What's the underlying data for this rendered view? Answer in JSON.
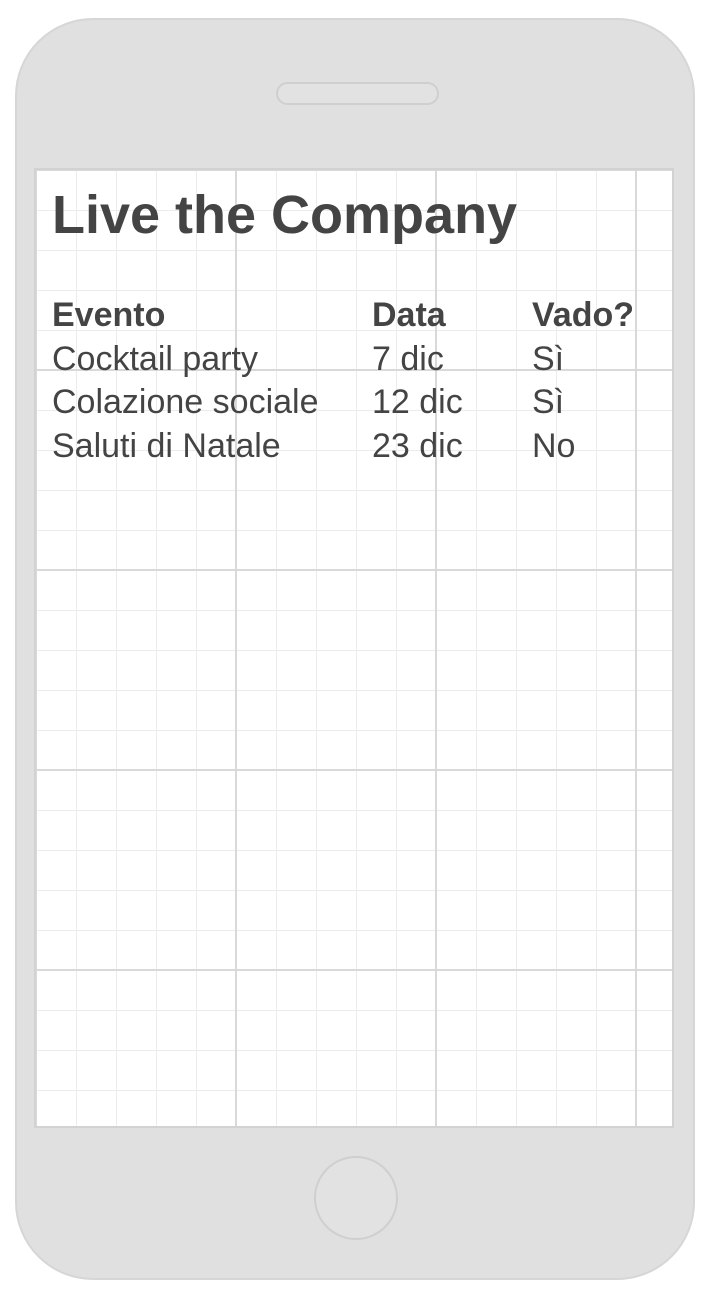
{
  "app": {
    "title": "Live the Company"
  },
  "table": {
    "headers": {
      "event": "Evento",
      "date": "Data",
      "going": "Vado?"
    },
    "rows": [
      {
        "event": "Cocktail party",
        "date": "7 dic",
        "going": "Sì"
      },
      {
        "event": "Colazione sociale",
        "date": "12 dic",
        "going": "Sì"
      },
      {
        "event": "Saluti di Natale",
        "date": "23 dic",
        "going": "No"
      }
    ]
  }
}
